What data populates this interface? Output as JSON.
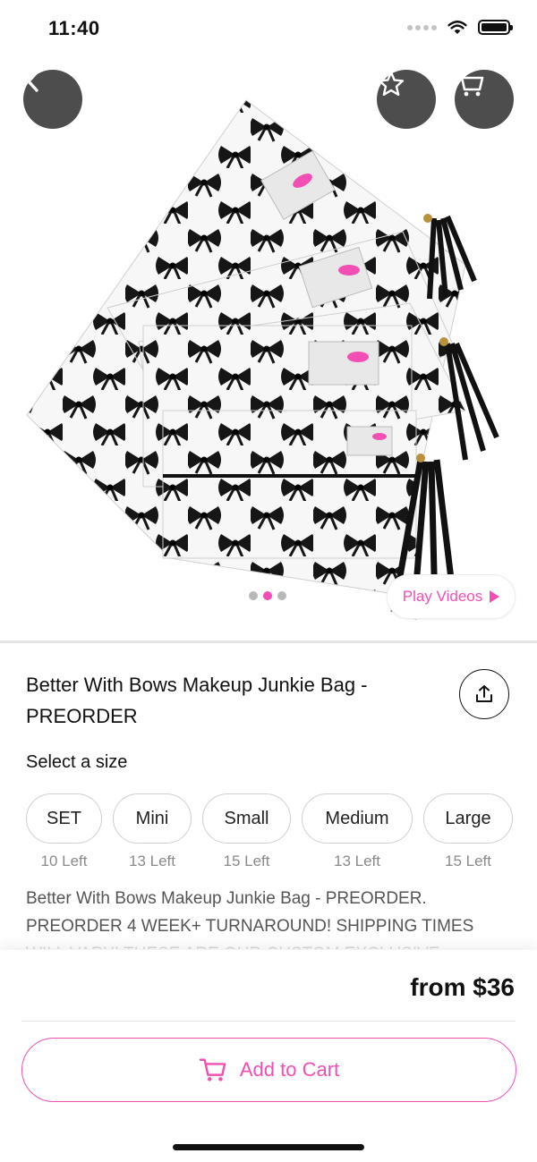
{
  "status_bar": {
    "time": "11:40"
  },
  "colors": {
    "accent": "#f24fb5",
    "hero_button_bg": "#4d4d4d",
    "muted_text": "#8a8a8a"
  },
  "hero": {
    "icons": {
      "back": "chevron-left-icon",
      "favorite": "star-icon",
      "cart": "cart-icon"
    },
    "pager": {
      "count": 3,
      "active_index": 1
    },
    "play_videos_label": "Play Videos"
  },
  "product": {
    "title": "Better With Bows Makeup Junkie Bag - PREORDER",
    "share_icon": "share-icon",
    "size_prompt": "Select a size",
    "sizes": [
      {
        "label": "SET",
        "stock": "10 Left"
      },
      {
        "label": "Mini",
        "stock": "13 Left"
      },
      {
        "label": "Small",
        "stock": "15 Left"
      },
      {
        "label": "Medium",
        "stock": "13 Left"
      },
      {
        "label": "Large",
        "stock": "15 Left"
      }
    ],
    "description": "Better With Bows Makeup Junkie Bag - PREORDER. PREORDER 4 WEEK+ TURNAROUND! SHIPPING TIMES WILL VARY! THESE ARE OUR CUSTOM EXCLUSIVE MAKEUP"
  },
  "footer": {
    "price": "from $36",
    "add_to_cart_label": "Add to Cart"
  }
}
